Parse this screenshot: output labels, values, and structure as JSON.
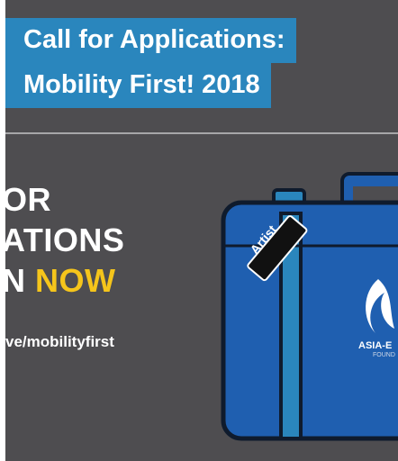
{
  "header": {
    "title_line_1": "Call for Applications:",
    "title_line_2": "Mobility First! 2018"
  },
  "poster": {
    "cta_line_1": "OR",
    "cta_line_2": "ATIONS",
    "cta_line_3_prefix": "N",
    "cta_line_3_highlight": "NOW",
    "url": "ve/mobilityfirst",
    "tag_text": "Artist",
    "suitcase_logo_text": "ASIA-E",
    "suitcase_logo_subtext": "FOUND"
  },
  "colors": {
    "background": "#4e4d50",
    "title_box": "#2a86bd",
    "highlight_yellow": "#f5c51b",
    "suitcase_blue": "#1f5fb0"
  }
}
